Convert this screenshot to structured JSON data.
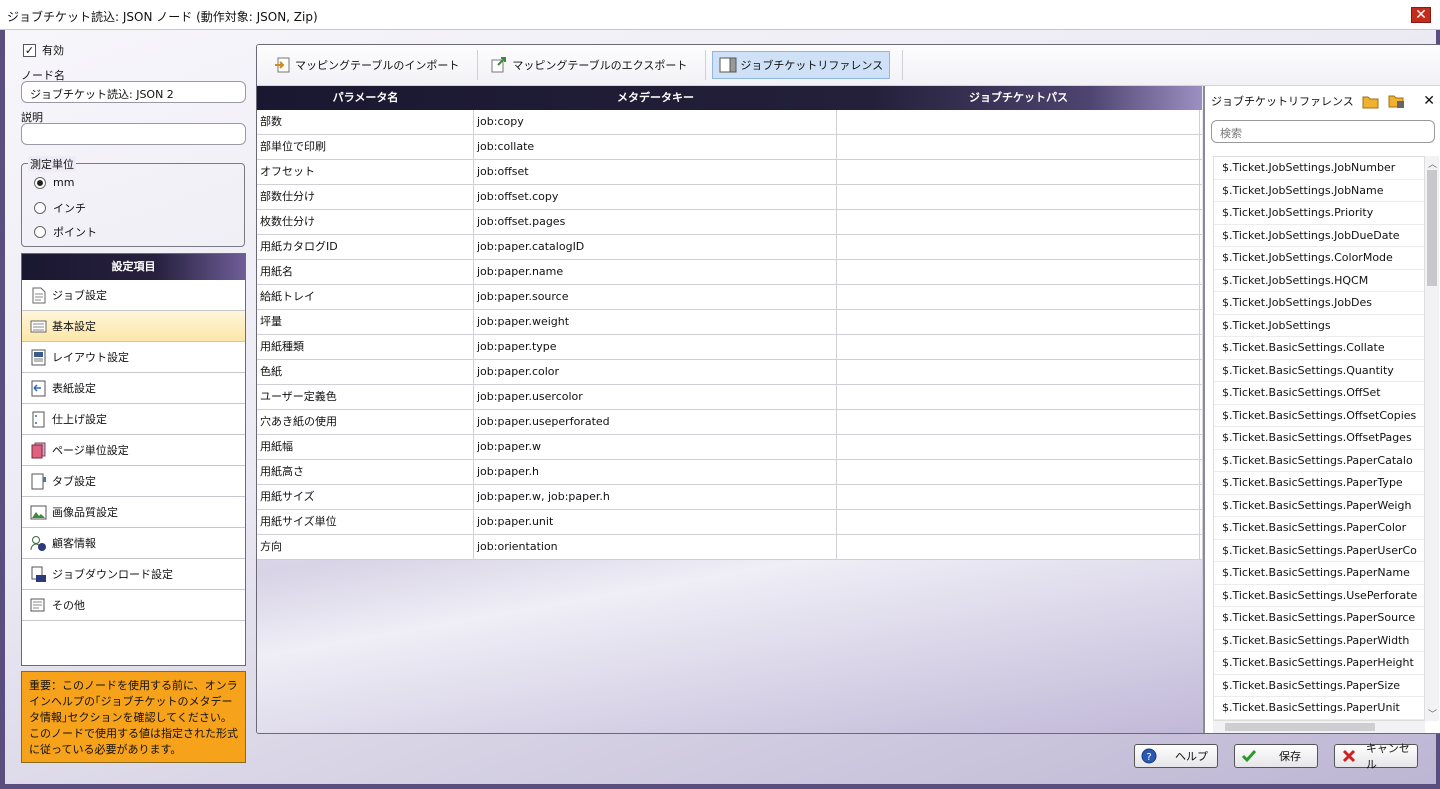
{
  "window": {
    "title": "ジョブチケット読込: JSON ノード (動作対象: JSON, Zip)",
    "close": "✕"
  },
  "left": {
    "enabled_label": "有効",
    "node_name_label": "ノード名",
    "node_name_value": "ジョブチケット読込: JSON 2",
    "description_label": "説明",
    "description_value": "",
    "units": {
      "legend": "測定単位",
      "options": [
        "mm",
        "インチ",
        "ポイント"
      ],
      "selected": "mm"
    },
    "categories": {
      "header": "設定項目",
      "items": [
        "ジョブ設定",
        "基本設定",
        "レイアウト設定",
        "表紙設定",
        "仕上げ設定",
        "ページ単位設定",
        "タブ設定",
        "画像品質設定",
        "顧客情報",
        "ジョブダウンロード設定",
        "その他"
      ],
      "selected": "基本設定"
    },
    "warning": "重要：このノードを使用する前に、オンラインヘルプの｢ジョブチケットのメタデータ情報｣セクションを確認してください。このノードで使用する値は指定された形式に従っている必要があります。"
  },
  "toolbar": {
    "import_label": "マッピングテーブルのインポート",
    "export_label": "マッピングテーブルのエクスポート",
    "reference_label": "ジョブチケットリファレンス"
  },
  "grid": {
    "columns": [
      "パラメータ名",
      "メタデータキー",
      "ジョブチケットパス"
    ],
    "rows": [
      [
        "部数",
        "job:copy",
        ""
      ],
      [
        "部単位で印刷",
        "job:collate",
        ""
      ],
      [
        "オフセット",
        "job:offset",
        ""
      ],
      [
        "部数仕分け",
        "job:offset.copy",
        ""
      ],
      [
        "枚数仕分け",
        "job:offset.pages",
        ""
      ],
      [
        "用紙カタログID",
        "job:paper.catalogID",
        ""
      ],
      [
        "用紙名",
        "job:paper.name",
        ""
      ],
      [
        "給紙トレイ",
        "job:paper.source",
        ""
      ],
      [
        "坪量",
        "job:paper.weight",
        ""
      ],
      [
        "用紙種類",
        "job:paper.type",
        ""
      ],
      [
        "色紙",
        "job:paper.color",
        ""
      ],
      [
        "ユーザー定義色",
        "job:paper.usercolor",
        ""
      ],
      [
        "穴あき紙の使用",
        "job:paper.useperforated",
        ""
      ],
      [
        "用紙幅",
        "job:paper.w",
        ""
      ],
      [
        "用紙高さ",
        "job:paper.h",
        ""
      ],
      [
        "用紙サイズ",
        "job:paper.w, job:paper.h",
        ""
      ],
      [
        "用紙サイズ単位",
        "job:paper.unit",
        ""
      ],
      [
        "方向",
        "job:orientation",
        ""
      ]
    ]
  },
  "reference": {
    "title": "ジョブチケットリファレンス",
    "search_placeholder": "検索",
    "items": [
      "$.Ticket.JobSettings.JobNumber",
      "$.Ticket.JobSettings.JobName",
      "$.Ticket.JobSettings.Priority",
      "$.Ticket.JobSettings.JobDueDate",
      "$.Ticket.JobSettings.ColorMode",
      "$.Ticket.JobSettings.HQCM",
      "$.Ticket.JobSettings.JobDes",
      "$.Ticket.JobSettings",
      "$.Ticket.BasicSettings.Collate",
      "$.Ticket.BasicSettings.Quantity",
      "$.Ticket.BasicSettings.OffSet",
      "$.Ticket.BasicSettings.OffsetCopies",
      "$.Ticket.BasicSettings.OffsetPages",
      "$.Ticket.BasicSettings.PaperCatalo",
      "$.Ticket.BasicSettings.PaperType",
      "$.Ticket.BasicSettings.PaperWeigh",
      "$.Ticket.BasicSettings.PaperColor",
      "$.Ticket.BasicSettings.PaperUserCo",
      "$.Ticket.BasicSettings.PaperName",
      "$.Ticket.BasicSettings.UsePerforate",
      "$.Ticket.BasicSettings.PaperSource",
      "$.Ticket.BasicSettings.PaperWidth",
      "$.Ticket.BasicSettings.PaperHeight",
      "$.Ticket.BasicSettings.PaperSize",
      "$.Ticket.BasicSettings.PaperUnit"
    ]
  },
  "buttons": {
    "help": "ヘルプ",
    "save": "保存",
    "cancel": "キャンセル"
  },
  "colors": {
    "accent_dark": "#1a1730",
    "accent_purple": "#6d5e97",
    "warning": "#f7a21b",
    "selected_tab": "#cfe1f7"
  }
}
